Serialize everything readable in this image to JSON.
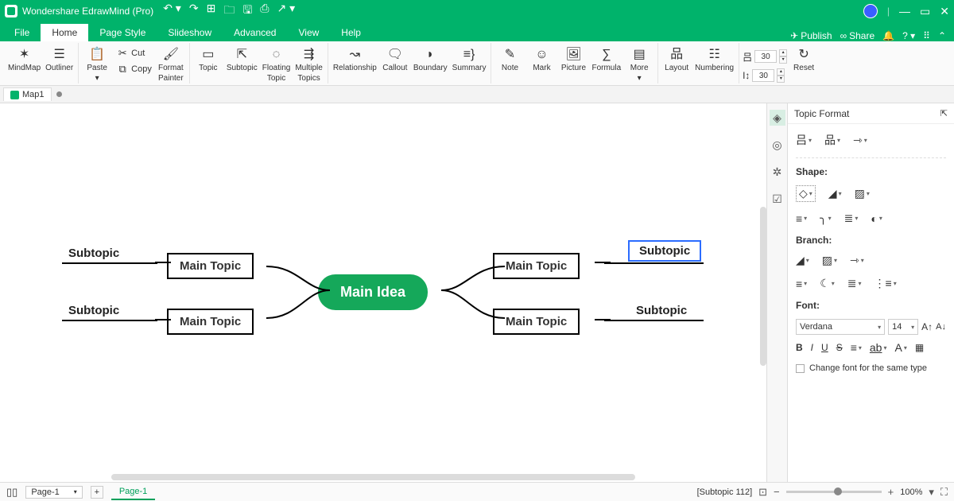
{
  "app": {
    "title": "Wondershare EdrawMind (Pro)"
  },
  "menu": {
    "items": [
      "File",
      "Home",
      "Page Style",
      "Slideshow",
      "Advanced",
      "View",
      "Help"
    ],
    "right": {
      "publish": "Publish",
      "share": "Share"
    }
  },
  "ribbon": {
    "mindmap": "MindMap",
    "outliner": "Outliner",
    "paste": "Paste",
    "cut": "Cut",
    "copy": "Copy",
    "formatpainter_l1": "Format",
    "formatpainter_l2": "Painter",
    "topic": "Topic",
    "subtopic": "Subtopic",
    "floating_l1": "Floating",
    "floating_l2": "Topic",
    "multiple_l1": "Multiple",
    "multiple_l2": "Topics",
    "relationship": "Relationship",
    "callout": "Callout",
    "boundary": "Boundary",
    "summary": "Summary",
    "note": "Note",
    "mark": "Mark",
    "picture": "Picture",
    "formula": "Formula",
    "more": "More",
    "layout": "Layout",
    "numbering": "Numbering",
    "width_val": "30",
    "height_val": "30",
    "reset": "Reset"
  },
  "doc": {
    "tab_name": "Map1"
  },
  "mind": {
    "central": "Main Idea",
    "main_tl": "Main Topic",
    "main_bl": "Main Topic",
    "main_tr": "Main Topic",
    "main_br": "Main Topic",
    "sub_tl": "Subtopic",
    "sub_bl": "Subtopic",
    "sub_tr": "Subtopic",
    "sub_br": "Subtopic"
  },
  "panel": {
    "title": "Topic Format",
    "shape_label": "Shape:",
    "branch_label": "Branch:",
    "font_label": "Font:",
    "font_name": "Verdana",
    "font_size": "14",
    "same_type": "Change font for the same type"
  },
  "status": {
    "page_dd": "Page-1",
    "page_tab": "Page-1",
    "selection": "[Subtopic 112]",
    "zoom": "100%"
  }
}
